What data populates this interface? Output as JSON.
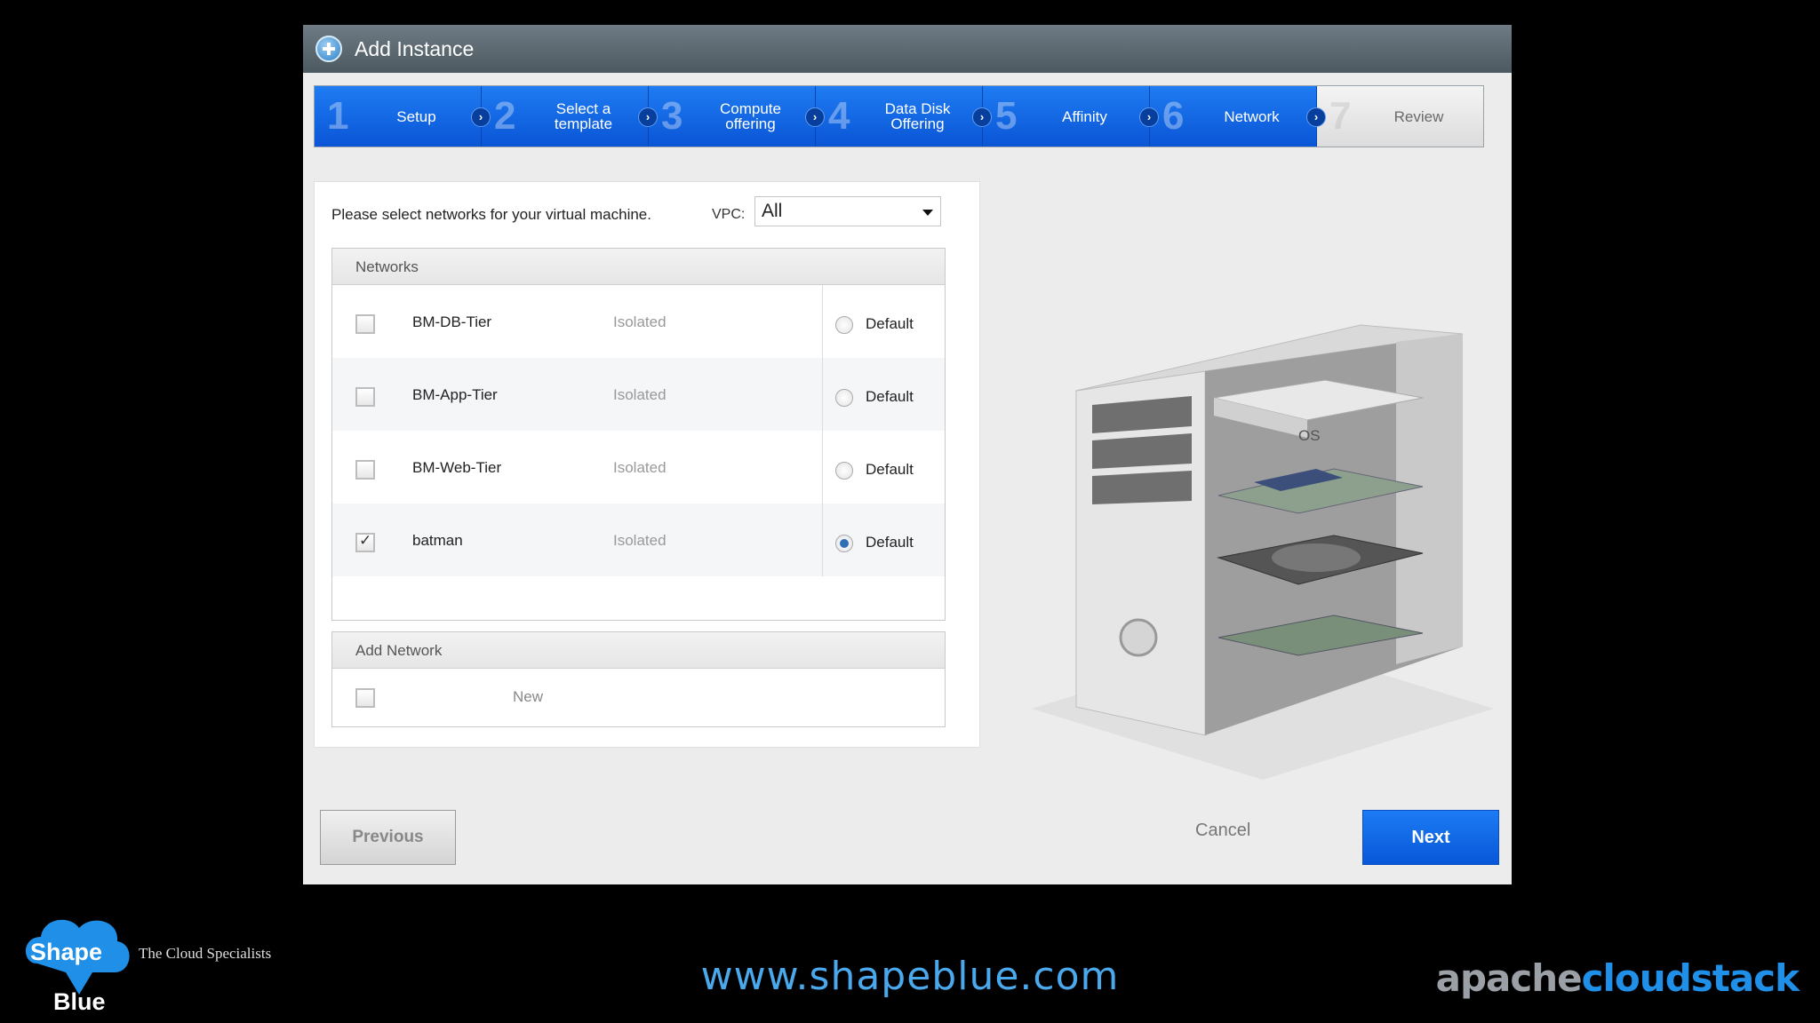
{
  "dialog": {
    "title": "Add Instance",
    "steps": [
      {
        "num": "1",
        "label": "Setup",
        "active": true
      },
      {
        "num": "2",
        "label": "Select a template",
        "active": true
      },
      {
        "num": "3",
        "label": "Compute offering",
        "active": true
      },
      {
        "num": "4",
        "label": "Data Disk Offering",
        "active": true
      },
      {
        "num": "5",
        "label": "Affinity",
        "active": true
      },
      {
        "num": "6",
        "label": "Network",
        "active": true
      },
      {
        "num": "7",
        "label": "Review",
        "active": false
      }
    ]
  },
  "network": {
    "prompt": "Please select networks for your virtual machine.",
    "vpc_label": "VPC:",
    "vpc_value": "All",
    "networks_header": "Networks",
    "rows": [
      {
        "name": "BM-DB-Tier",
        "type": "Isolated",
        "default_label": "Default",
        "checked": false,
        "default": false
      },
      {
        "name": "BM-App-Tier",
        "type": "Isolated",
        "default_label": "Default",
        "checked": false,
        "default": false
      },
      {
        "name": "BM-Web-Tier",
        "type": "Isolated",
        "default_label": "Default",
        "checked": false,
        "default": false
      },
      {
        "name": "batman",
        "type": "Isolated",
        "default_label": "Default",
        "checked": true,
        "default": true
      }
    ],
    "add_network_header": "Add Network",
    "new_label": "New",
    "illustration_text": "OS"
  },
  "buttons": {
    "previous": "Previous",
    "cancel": "Cancel",
    "next": "Next"
  },
  "footer": {
    "logo_top": "Shape",
    "logo_bottom": "Blue",
    "tagline": "The Cloud Specialists",
    "url": "www.shapeblue.com",
    "brand_part1": "apache",
    "brand_part2": "cloudstack"
  },
  "colors": {
    "step_active": "#0a55d6",
    "next_button": "#1c7bf4",
    "url": "#4aa8ec"
  }
}
